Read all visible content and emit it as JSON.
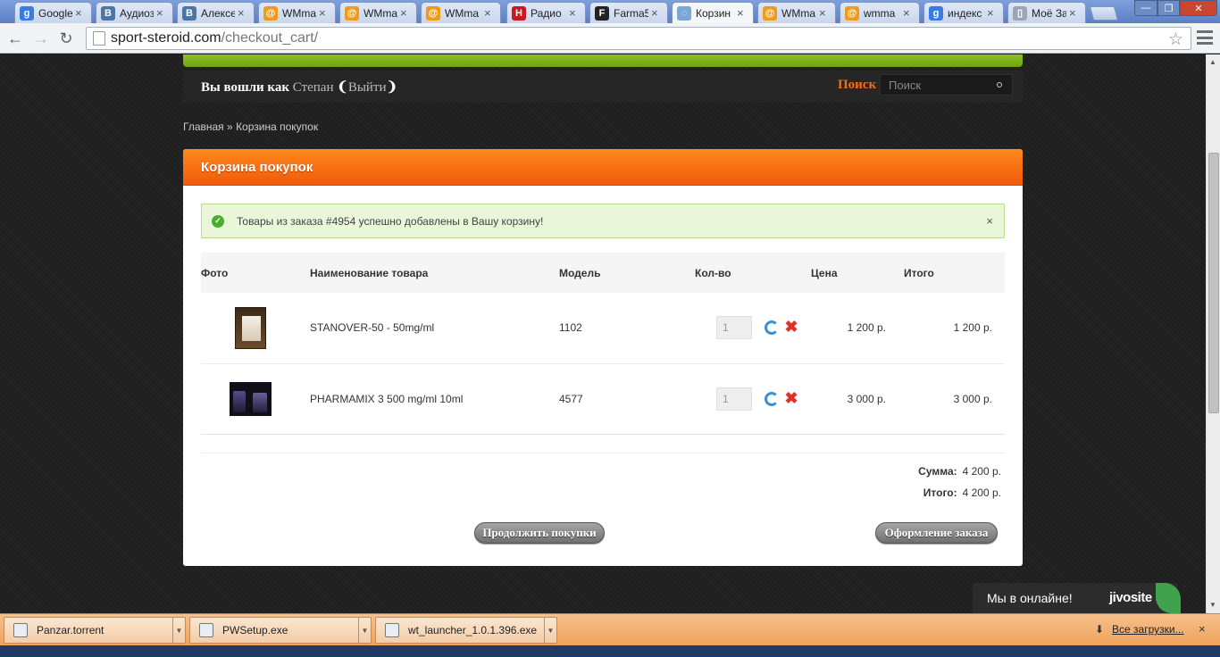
{
  "browser": {
    "tabs": [
      {
        "label": "Google",
        "icon": "google-icon",
        "color": "#3a7be0",
        "glyph": "g"
      },
      {
        "label": "Аудиоз",
        "icon": "vk-icon",
        "color": "#4c75a3",
        "glyph": "B"
      },
      {
        "label": "Алексе",
        "icon": "vk-icon",
        "color": "#4c75a3",
        "glyph": "B"
      },
      {
        "label": "WMma",
        "icon": "wm-icon",
        "color": "#f09a1a",
        "glyph": "@"
      },
      {
        "label": "WMma",
        "icon": "wm-icon",
        "color": "#f09a1a",
        "glyph": "@"
      },
      {
        "label": "WMma",
        "icon": "wm-icon",
        "color": "#f09a1a",
        "glyph": "@"
      },
      {
        "label": "Радио",
        "icon": "radio-icon",
        "color": "#c9191f",
        "glyph": "H"
      },
      {
        "label": "Farma5",
        "icon": "farma-icon",
        "color": "#222222",
        "glyph": "F"
      },
      {
        "label": "Корзин",
        "icon": "loading-icon",
        "color": "#7aa7d6",
        "glyph": "◌",
        "active": true
      },
      {
        "label": "WMma",
        "icon": "wm-icon",
        "color": "#f09a1a",
        "glyph": "@"
      },
      {
        "label": "wmma",
        "icon": "wm-icon",
        "color": "#f09a1a",
        "glyph": "@"
      },
      {
        "label": "индекс",
        "icon": "google-icon",
        "color": "#3a7be0",
        "glyph": "g"
      },
      {
        "label": "Моё За",
        "icon": "page-icon",
        "color": "#9aa6b8",
        "glyph": "▯"
      }
    ],
    "url_host": "sport-steroid.com",
    "url_path": "/checkout_cart/"
  },
  "site": {
    "login_prefix": "Вы вошли как",
    "username": "Степан",
    "logout": "Выйти",
    "search_label": "Поиск",
    "search_placeholder": "Поиск"
  },
  "breadcrumb": {
    "home": "Главная",
    "sep": "»",
    "current": "Корзина покупок"
  },
  "cart": {
    "title": "Корзина покупок",
    "alert": "Товары из заказа #4954 успешно добавлены в Вашу корзину!",
    "alert_close": "×",
    "columns": {
      "photo": "Фото",
      "name": "Наименование товара",
      "model": "Модель",
      "qty": "Кол-во",
      "price": "Цена",
      "total": "Итого"
    },
    "items": [
      {
        "name": "STANOVER-50 - 50mg/ml",
        "model": "1102",
        "qty": "1",
        "price": "1 200 р.",
        "total": "1 200 р."
      },
      {
        "name": "PHARMAMIX 3 500 mg/ml 10ml",
        "model": "4577",
        "qty": "1",
        "price": "3 000 р.",
        "total": "3 000 р."
      }
    ],
    "subtotal_label": "Сумма:",
    "subtotal": "4 200 р.",
    "total_label": "Итого:",
    "total": "4 200 р.",
    "continue_button": "Продолжить покупки",
    "checkout_button": "Оформление заказа"
  },
  "chat": {
    "text": "Мы в онлайне!",
    "logo": "jivosite"
  },
  "downloads": {
    "items": [
      "Panzar.torrent",
      "PWSetup.exe",
      "wt_launcher_1.0.1.396.exe"
    ],
    "all_label": "Все загрузки...",
    "close": "×"
  }
}
